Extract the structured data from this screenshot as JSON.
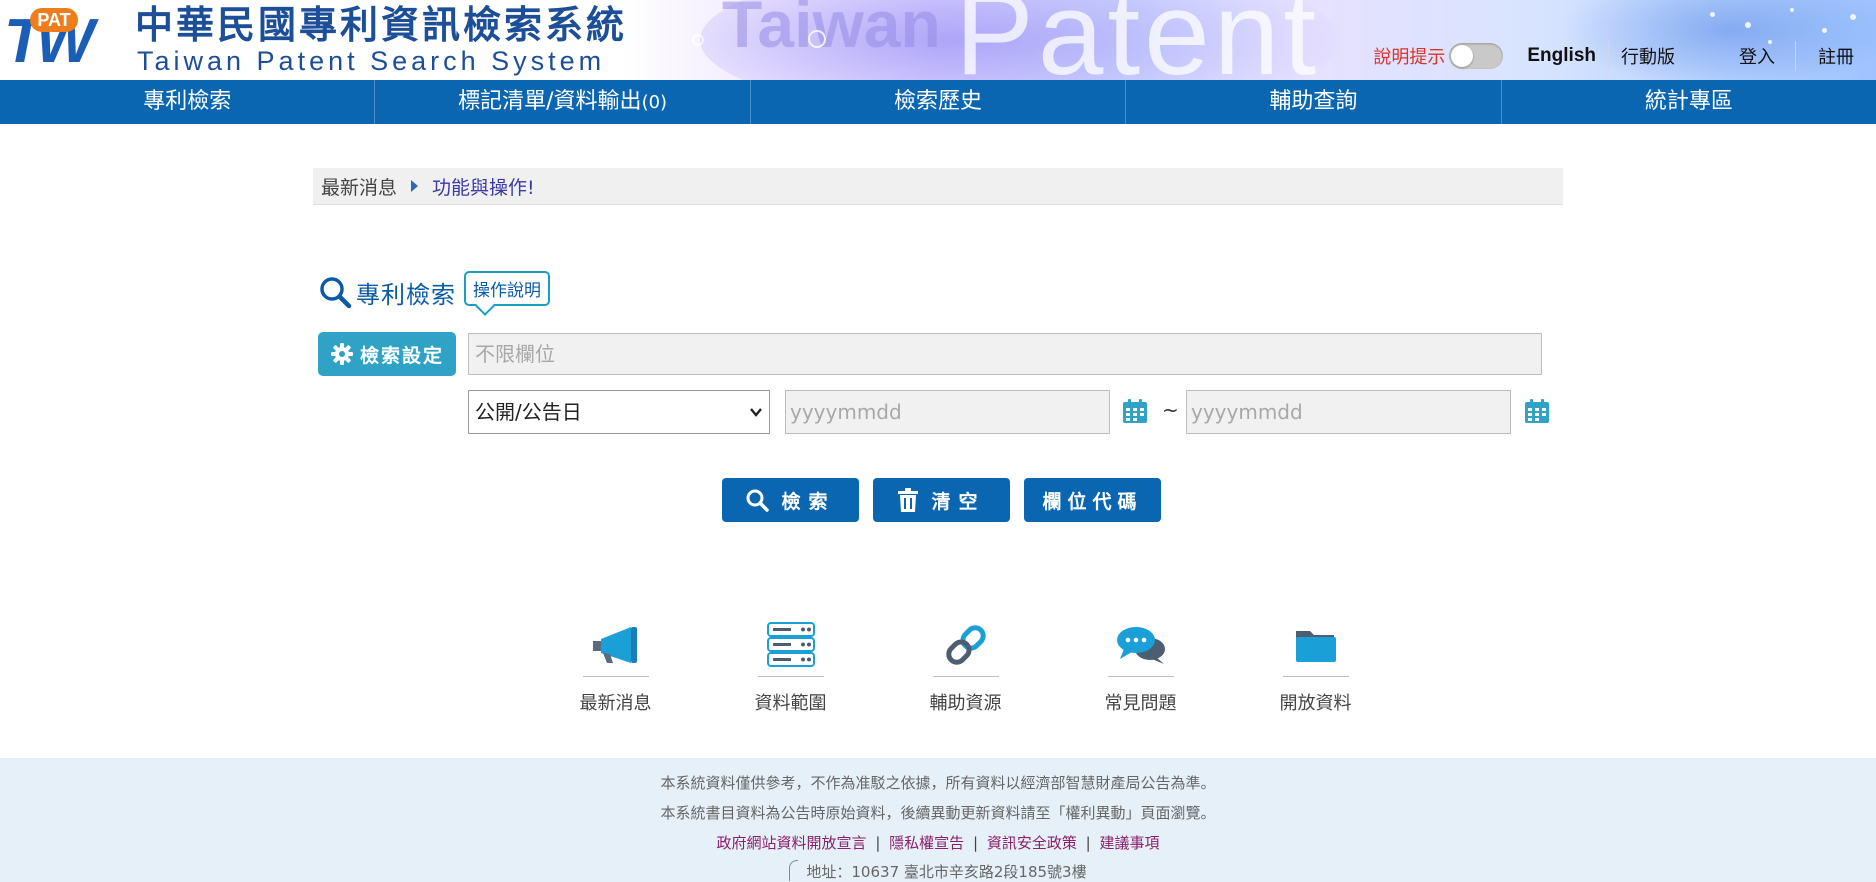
{
  "header": {
    "logo": {
      "mark": "TW",
      "badge": "PAT"
    },
    "title_cn": "中華民國專利資訊檢索系統",
    "title_en": "Taiwan Patent Search System",
    "bg_word_1": "Taiwan",
    "bg_word_2": "Patent",
    "hint_label": "說明提示",
    "hint_toggle_on": false,
    "links": {
      "english": "English",
      "mobile": "行動版",
      "login": "登入",
      "register": "註冊"
    }
  },
  "nav": {
    "items": [
      {
        "label": "專利檢索"
      },
      {
        "label": "標記清單/資料輸出",
        "count": "(0)"
      },
      {
        "label": "檢索歷史"
      },
      {
        "label": "輔助查詢"
      },
      {
        "label": "統計專區"
      }
    ]
  },
  "news": {
    "label": "最新消息",
    "link": "功能與操作!"
  },
  "search": {
    "title": "專利檢索",
    "help_label": "操作說明",
    "settings_label": "檢索設定",
    "keyword_placeholder": "不限欄位",
    "date_field": {
      "selected": "公開/公告日"
    },
    "date_from_placeholder": "yyyymmdd",
    "date_separator": "~",
    "date_to_placeholder": "yyyymmdd",
    "buttons": {
      "search": "檢索",
      "clear": "清空",
      "field_code": "欄位代碼"
    }
  },
  "quick_links": [
    {
      "label": "最新消息",
      "icon": "megaphone-icon"
    },
    {
      "label": "資料範圍",
      "icon": "database-icon"
    },
    {
      "label": "輔助資源",
      "icon": "link-icon"
    },
    {
      "label": "常見問題",
      "icon": "chat-bubbles-icon"
    },
    {
      "label": "開放資料",
      "icon": "folder-icon"
    }
  ],
  "footer": {
    "disclaimer_1": "本系統資料僅供參考，不作為准駁之依據，所有資料以經濟部智慧財產局公告為準。",
    "disclaimer_2": "本系統書目資料為公告時原始資料，後續異動更新資料請至「權利異動」頁面瀏覽。",
    "links": [
      "政府網站資料開放宣言",
      "隱私權宣告",
      "資訊安全政策",
      "建議事項"
    ],
    "link_separator": "|",
    "address": "地址：10637 臺北市辛亥路2段185號3樓"
  },
  "colors": {
    "nav_blue": "#0a66b0",
    "settings_teal": "#2fa2c6",
    "hint_red": "#d9342b",
    "footer_bg": "#e6f0f8",
    "footer_link": "#8a1f6a"
  }
}
